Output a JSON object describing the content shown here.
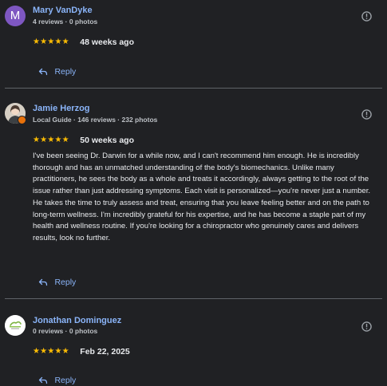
{
  "colors": {
    "background": "#202124",
    "name_link": "#8ab4f8",
    "star": "#fbbc04",
    "text": "#e8eaed",
    "meta_text": "#bdc1c6",
    "divider": "#5f6368",
    "avatar_purple": "#7e57c2",
    "local_guide_badge": "#e8710a"
  },
  "reviews": [
    {
      "avatar": {
        "type": "letter",
        "letter": "M"
      },
      "name": "Mary VanDyke",
      "meta": "4 reviews · 0 photos",
      "rating": 5,
      "stars": "★★★★★",
      "date": "48 weeks ago",
      "text": "",
      "reply_label": "Reply",
      "icons": {
        "info": "alert-circle-icon",
        "reply": "reply-arrow-icon"
      }
    },
    {
      "avatar": {
        "type": "photo",
        "badge": "local-guide-badge"
      },
      "name": "Jamie Herzog",
      "meta": "Local Guide · 146 reviews · 232 photos",
      "rating": 5,
      "stars": "★★★★★",
      "date": "50 weeks ago",
      "text": "I've been seeing Dr. Darwin for a while now, and I can't recommend him enough. He is incredibly thorough and has an unmatched understanding of the body's biomechanics. Unlike many practitioners, he sees the body as a whole and treats it accordingly, always getting to the root of the issue rather than just addressing symptoms. Each visit is personalized—you're never just a number. He takes the time to truly assess and treat, ensuring that you leave feeling better and on the path to long-term wellness. I'm incredibly grateful for his expertise, and he has become a staple part of my health and wellness routine. If you're looking for a chiropractor who genuinely cares and delivers results, look no further.",
      "reply_label": "Reply",
      "icons": {
        "info": "alert-circle-icon",
        "reply": "reply-arrow-icon"
      }
    },
    {
      "avatar": {
        "type": "logo"
      },
      "name": "Jonathan Dominguez",
      "meta": "0 reviews · 0 photos",
      "rating": 5,
      "stars": "★★★★★",
      "date": "Feb 22, 2025",
      "text": "",
      "reply_label": "Reply",
      "icons": {
        "info": "alert-circle-icon",
        "reply": "reply-arrow-icon"
      }
    }
  ]
}
